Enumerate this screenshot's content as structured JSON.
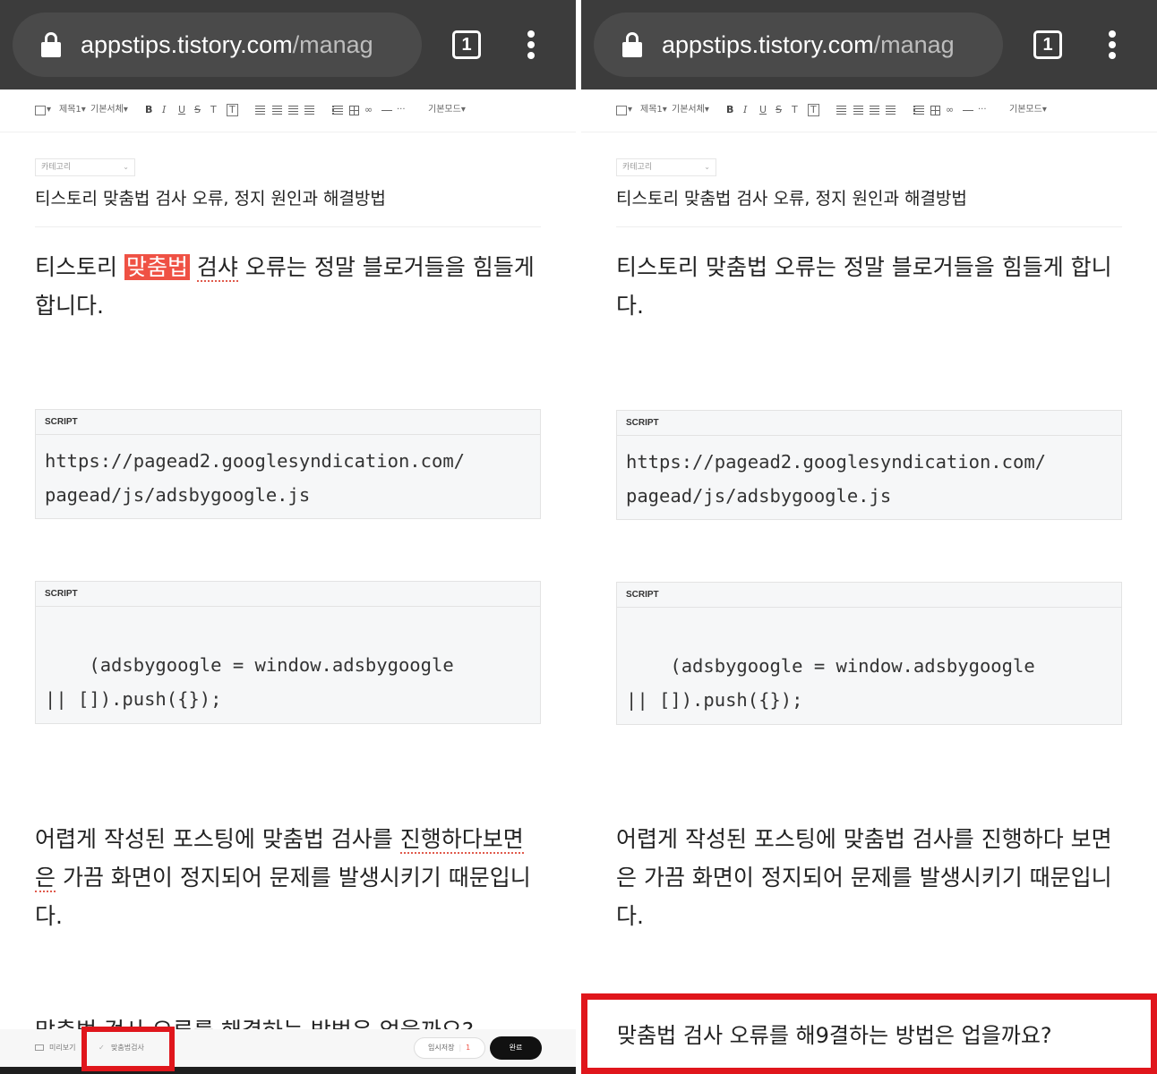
{
  "browser": {
    "url_host": "appstips.tistory.com",
    "url_path": "/manag",
    "tab_count": "1"
  },
  "toolbar": {
    "heading_label": "제목1",
    "font_label": "기본서체",
    "mode_label": "기본모드",
    "bold": "B",
    "italic": "I",
    "underline": "U",
    "strike": "S",
    "text_color": "T",
    "text_bg": "T",
    "more": "···"
  },
  "editor": {
    "category_label": "카테고리",
    "post_title": "티스토리 맞춤법 검사 오류, 정지 원인과 해결방법",
    "code_label": "SCRIPT",
    "code1_line1": "https://pagead2.googlesyndication.com/",
    "code1_line2": "pagead/js/adsbygoogle.js",
    "code2_line1": "    (adsbygoogle = window.adsbygoogle",
    "code2_line2": "|| []).push({});"
  },
  "left": {
    "p1_a": "티스토리 ",
    "p1_hl": "맞춤법",
    "p1_b": " ",
    "p1_sp": "검샤",
    "p1_c": " 오류는 정말 블로거들을 힘들게 합니다.",
    "p2_a": "어렵게 작성된 포스팅에 맞춤법 검사를 ",
    "p2_sp": "진행하다보면",
    "p2_sp2": "은",
    "p2_c": " 가끔 화면이 정지되어 문제를 발생시키기 때문입니다.",
    "peek": "맞춤법 검사 오류를 해결하는 방법은 없을까요?"
  },
  "right": {
    "p1": "티스토리 맞춤법 오류는 정말 블로거들을 힘들게 합니다.",
    "p2": "어렵게 작성된 포스팅에 맞춤법 검사를 진행하다 보면은 가끔 화면이 정지되어 문제를 발생시키기 때문입니다.",
    "highlight_text": "맞춤법 검사 오류를 해9결하는 방법은 업을까요?"
  },
  "bottom_bar": {
    "preview": "미리보기",
    "spell_check": "맞춤법검사",
    "temp_save": "임시저장",
    "temp_count": "1",
    "done": "완료"
  },
  "colors": {
    "browser_bar": "#3c3c3c",
    "highlight": "#ef5144",
    "annotation_red": "#e0161c",
    "done_button": "#111111"
  }
}
